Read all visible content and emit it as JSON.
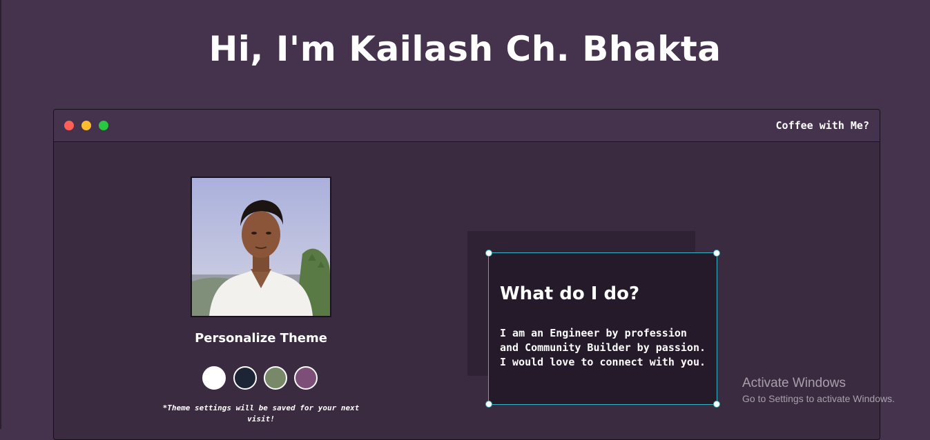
{
  "header": {
    "title": "Hi, I'm Kailash Ch. Bhakta"
  },
  "window": {
    "titlebar": {
      "dots": [
        "close-icon",
        "minimize-icon",
        "maximize-icon"
      ],
      "link_label": "Coffee with Me?"
    }
  },
  "profile": {
    "photo_alt": "Profile photo"
  },
  "theme": {
    "heading": "Personalize Theme",
    "swatches": [
      {
        "name": "white",
        "color": "#ffffff"
      },
      {
        "name": "navy",
        "color": "#1b2535"
      },
      {
        "name": "sage",
        "color": "#78896a"
      },
      {
        "name": "plum",
        "color": "#7c4e78"
      }
    ],
    "note": "*Theme settings will be saved for your next visit!"
  },
  "about": {
    "heading": "What do I do?",
    "text": "I am an Engineer by profession and Community Builder by passion. I would love to connect with you."
  },
  "watermark": {
    "title": "Activate Windows",
    "subtitle": "Go to Settings to activate Windows."
  }
}
